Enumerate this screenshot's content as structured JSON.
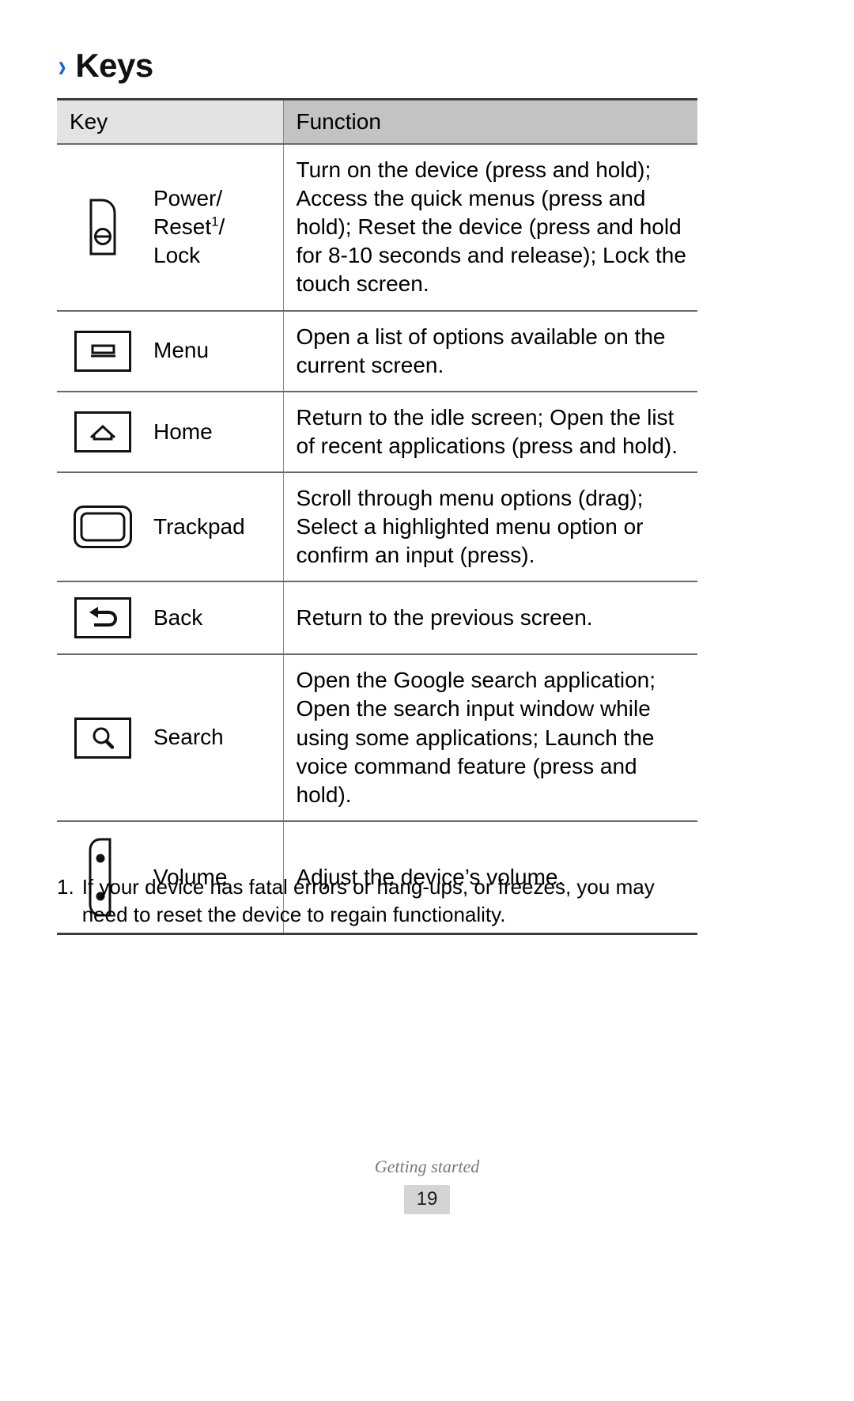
{
  "page": {
    "title": "Keys",
    "chevron": "›",
    "accent_color": "#1565e0"
  },
  "table": {
    "headers": {
      "key": "Key",
      "function": "Function"
    },
    "header_key_bg": "#e3e3e3",
    "header_function_bg": "#c3c3c3",
    "rows": [
      {
        "icon": "power-key-icon",
        "key_label": "Power/",
        "key_label_line2_pre": "Reset",
        "key_label_sup": "1",
        "key_label_line2_post": "/",
        "key_label_line3": "Lock",
        "function": "Turn on the device (press and hold); Access the quick menus (press and hold); Reset the device (press and hold for 8-10 seconds and release); Lock the touch screen."
      },
      {
        "icon": "menu-key-icon",
        "key_label": "Menu",
        "function": "Open a list of options available on the current screen."
      },
      {
        "icon": "home-key-icon",
        "key_label": "Home",
        "function": "Return to the idle screen; Open the list of recent applications (press and hold)."
      },
      {
        "icon": "trackpad-key-icon",
        "key_label": "Trackpad",
        "function": "Scroll through menu options (drag); Select a highlighted menu option or confirm an input (press)."
      },
      {
        "icon": "back-key-icon",
        "key_label": "Back",
        "function": "Return to the previous screen."
      },
      {
        "icon": "search-key-icon",
        "key_label": "Search",
        "function": "Open the Google search application; Open the search input window while using some applications; Launch the voice command feature (press and hold)."
      },
      {
        "icon": "volume-key-icon",
        "key_label": "Volume",
        "function": "Adjust the device’s volume."
      }
    ]
  },
  "footnote": {
    "number": "1.",
    "text": "If your device has fatal errors or hang-ups, or freezes, you may need to reset the device to regain functionality."
  },
  "footer": {
    "section": "Getting started",
    "page_number": "19"
  }
}
